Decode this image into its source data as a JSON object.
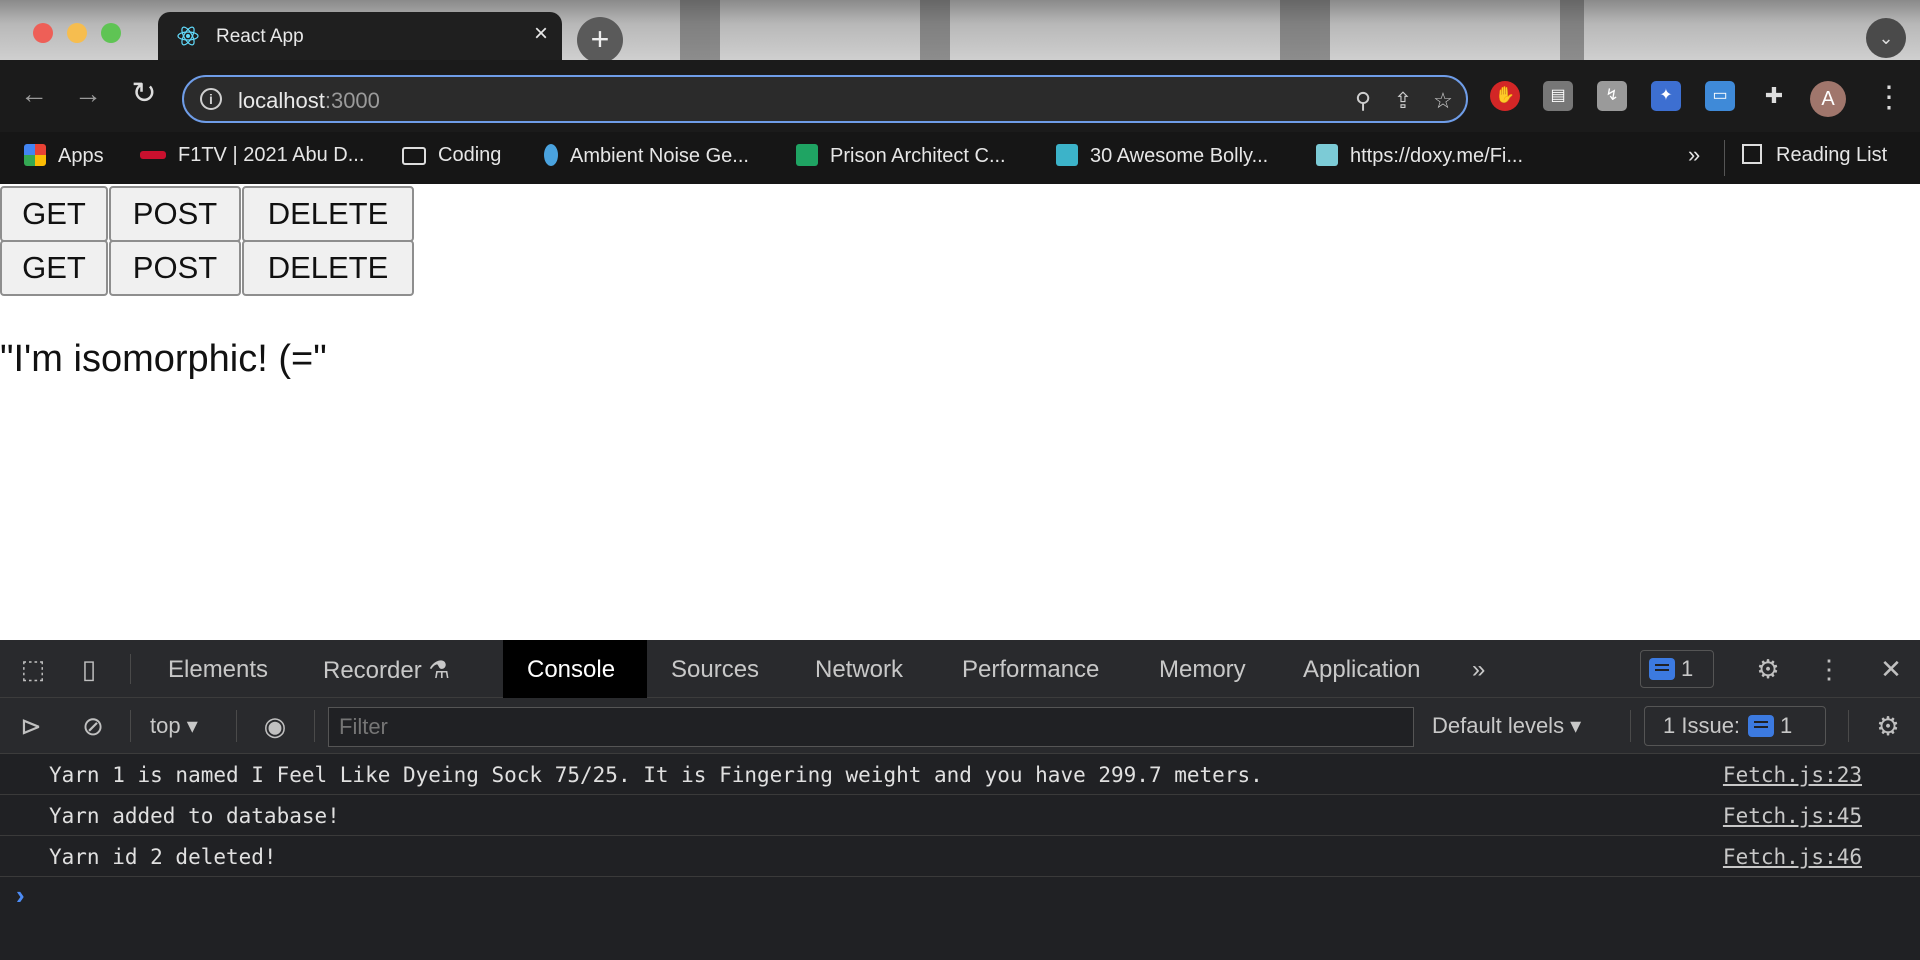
{
  "browser": {
    "tab_title": "React App",
    "url_host": "localhost",
    "url_port": ":3000",
    "bookmarks": [
      {
        "label": "Apps",
        "icon": "apps-grid-icon"
      },
      {
        "label": "F1TV | 2021 Abu D...",
        "icon": "f1-icon"
      },
      {
        "label": "Coding",
        "icon": "folder-icon"
      },
      {
        "label": "Ambient Noise Ge...",
        "icon": "drop-icon"
      },
      {
        "label": "Prison Architect C...",
        "icon": "sheet-icon"
      },
      {
        "label": "30 Awesome Bolly...",
        "icon": "image-icon"
      },
      {
        "label": "https://doxy.me/Fi...",
        "icon": "doxy-icon"
      }
    ],
    "more_bookmarks": "»",
    "reading_list": "Reading List",
    "avatar_letter": "A"
  },
  "page": {
    "button_rows": [
      {
        "get": "GET",
        "post": "POST",
        "delete": "DELETE"
      },
      {
        "get": "GET",
        "post": "POST",
        "delete": "DELETE"
      }
    ],
    "message": "\"I'm isomorphic! (=\""
  },
  "devtools": {
    "tabs": [
      "Elements",
      "Recorder",
      "Console",
      "Sources",
      "Network",
      "Performance",
      "Memory",
      "Application"
    ],
    "active_tab": "Console",
    "overflow": "»",
    "message_count": "1",
    "context": "top ▾",
    "filter_placeholder": "Filter",
    "levels": "Default levels ▾",
    "issues_label": "1 Issue:",
    "issues_count": "1",
    "logs": [
      {
        "message": "Yarn 1 is named I Feel Like Dyeing Sock 75/25. It is Fingering weight and you have 299.7 meters.",
        "source": "Fetch.js:23"
      },
      {
        "message": "Yarn added to database!",
        "source": "Fetch.js:45"
      },
      {
        "message": "Yarn id 2 deleted!",
        "source": "Fetch.js:46"
      }
    ],
    "prompt": "›"
  },
  "colors": {
    "accent": "#6f9de8",
    "devtools_bg": "#202124",
    "badge_blue": "#3c7ae0"
  }
}
